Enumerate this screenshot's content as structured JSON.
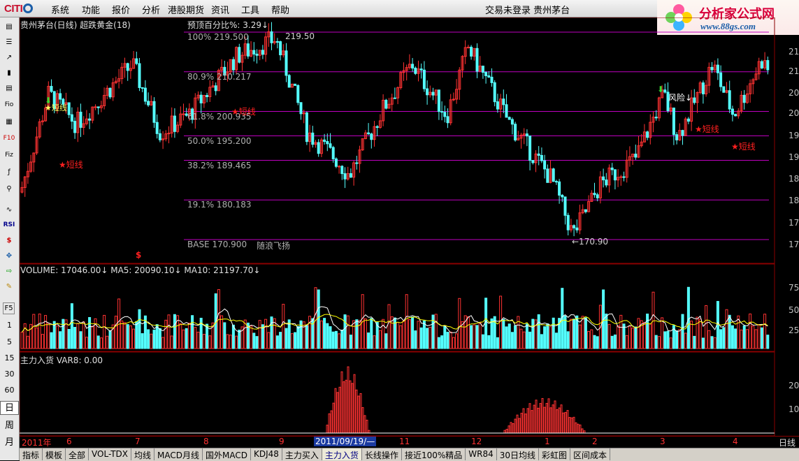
{
  "menubar": {
    "logo_text": "CITI",
    "items": [
      "系统",
      "功能",
      "报价",
      "分析",
      "港股期货",
      "资讯",
      "工具",
      "帮助"
    ],
    "login_status": "交易未登录",
    "stock_name": "贵州茅台"
  },
  "brand": {
    "title": "分析家公式网",
    "url": "www.88gs.com"
  },
  "left_toolbar": {
    "labels": [
      "Fio",
      "F10",
      "Fiz",
      "RSI",
      "F5",
      "1",
      "5",
      "15",
      "30",
      "60",
      "日",
      "周",
      "月"
    ]
  },
  "main_panel": {
    "title": "贵州茅台(日线) 超跌黄金(18)",
    "indicator_label": "预顶百分比%: 3.29↓",
    "fib_levels": [
      {
        "label": "100%  219.500",
        "value": 219.5
      },
      {
        "label": "80.9%  210.217",
        "value": 210.217
      },
      {
        "label": "61.8%  200.935",
        "value": 200.935
      },
      {
        "label": "50.0%  195.200",
        "value": 195.2
      },
      {
        "label": "38.2%  189.465",
        "value": 189.465
      },
      {
        "label": "19.1%  180.183",
        "value": 180.183
      }
    ],
    "base_label": "BASE  170.900",
    "base_value": 170.9,
    "base_note": "随浪飞扬",
    "high_marker": "219.50",
    "low_marker": "←170.90",
    "annotations": [
      "风险↓",
      "★短线",
      "★短线",
      "★短线",
      "★短线",
      "★短线",
      "$"
    ],
    "right_axis": [
      "21",
      "21",
      "20",
      "20",
      "19",
      "19",
      "18",
      "18",
      "17",
      "17"
    ]
  },
  "volume_panel": {
    "title": "VOLUME: 17046.00↓  MA5: 20090.10↓  MA10: 21197.70↓",
    "right_axis": [
      "75",
      "50",
      "25"
    ]
  },
  "sub_panel": {
    "title": "主力入货  VAR8: 0.00",
    "right_axis": [
      "20",
      "10"
    ]
  },
  "date_axis": {
    "labels": [
      "2011年",
      "6",
      "7",
      "8",
      "9",
      "2011/09/19/—",
      "11",
      "12",
      "1",
      "2",
      "3",
      "4",
      "日线"
    ],
    "cursor_date": "2011/09/19/—"
  },
  "bottom_tabs": [
    "指标",
    "模板",
    "全部",
    "VOL-TDX",
    "均线",
    "MACD月线",
    "国外MACD",
    "KDJ48",
    "主力买入",
    "主力入货",
    "长线操作",
    "接近100%精品",
    "WR84",
    "30日均线",
    "彩虹图",
    "区间成本"
  ],
  "active_tab": "主力入货",
  "colors": {
    "up": "#ff3232",
    "down": "#54ffff",
    "fib": "#c000c0",
    "bg": "#000000"
  }
}
